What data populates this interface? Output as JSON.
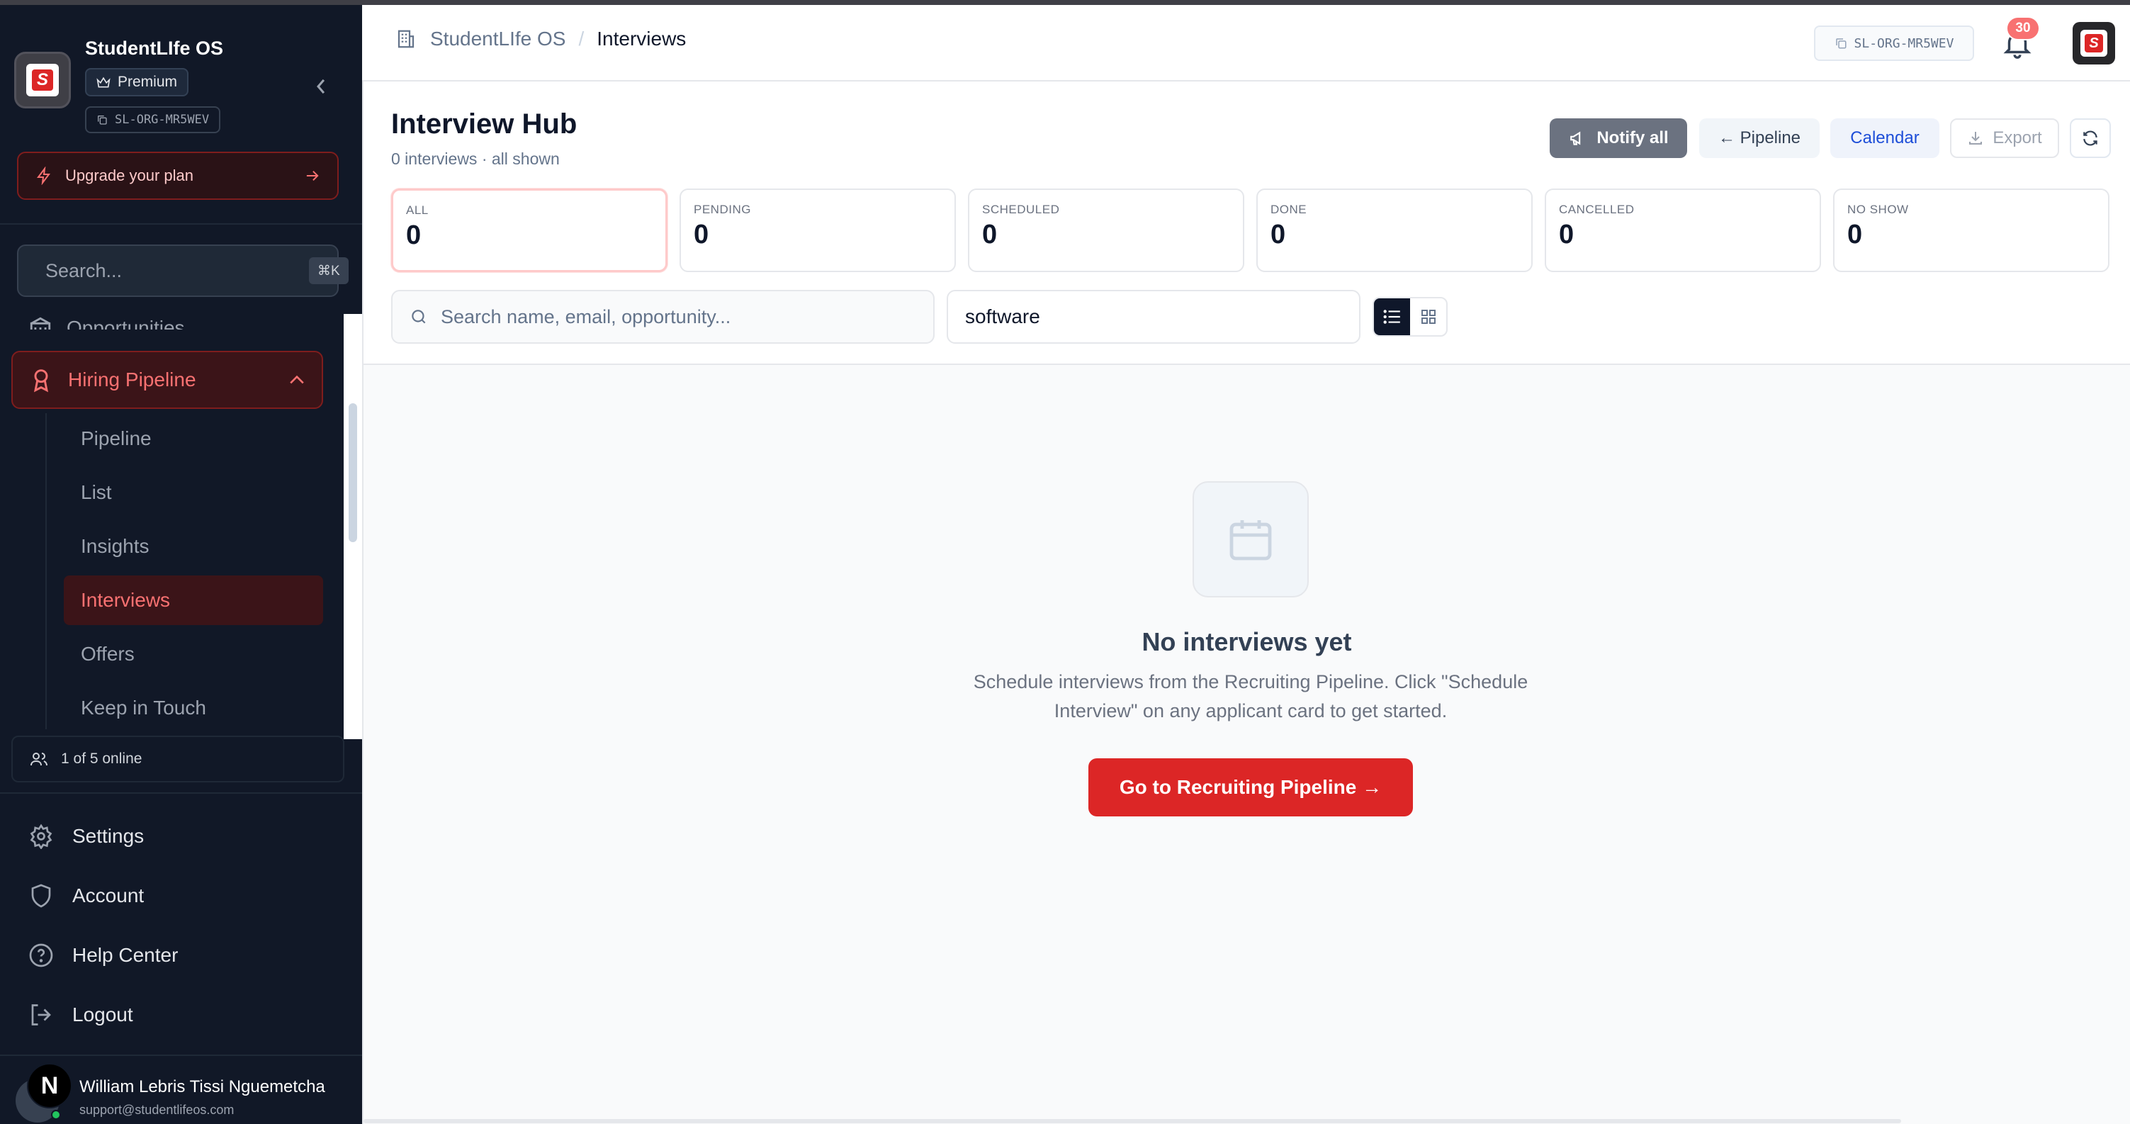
{
  "sidebar": {
    "app_name": "StudentLIfe OS",
    "plan_badge": "Premium",
    "org_id": "SL-ORG-MR5WEV",
    "upgrade_label": "Upgrade your plan",
    "search_placeholder": "Search...",
    "search_shortcut": "⌘K",
    "nav_partial_label": "Opportunities",
    "nav_group": {
      "label": "Hiring Pipeline",
      "items": [
        {
          "label": "Pipeline",
          "active": false
        },
        {
          "label": "List",
          "active": false
        },
        {
          "label": "Insights",
          "active": false
        },
        {
          "label": "Interviews",
          "active": true
        },
        {
          "label": "Offers",
          "active": false
        },
        {
          "label": "Keep in Touch",
          "active": false
        }
      ]
    },
    "online_status": "1 of 5 online",
    "bottom_items": [
      {
        "label": "Settings",
        "icon": "gear-icon"
      },
      {
        "label": "Account",
        "icon": "shield-icon"
      },
      {
        "label": "Help Center",
        "icon": "help-circle-icon"
      },
      {
        "label": "Logout",
        "icon": "logout-icon"
      }
    ],
    "user": {
      "initial": "N",
      "name": "William Lebris Tissi Nguemetcha",
      "email": "support@studentlifeos.com"
    }
  },
  "header": {
    "breadcrumb_org": "StudentLIfe OS",
    "breadcrumb_separator": "/",
    "breadcrumb_current": "Interviews",
    "org_id": "SL-ORG-MR5WEV",
    "notification_count": "30"
  },
  "page": {
    "title": "Interview Hub",
    "subtitle": "0 interviews · all shown",
    "buttons": {
      "notify_all": "Notify all",
      "pipeline": "← Pipeline",
      "calendar": "Calendar",
      "export": "Export"
    },
    "stats": [
      {
        "label": "ALL",
        "value": "0"
      },
      {
        "label": "PENDING",
        "value": "0"
      },
      {
        "label": "SCHEDULED",
        "value": "0"
      },
      {
        "label": "DONE",
        "value": "0"
      },
      {
        "label": "CANCELLED",
        "value": "0"
      },
      {
        "label": "NO SHOW",
        "value": "0"
      }
    ],
    "search_placeholder": "Search name, email, opportunity...",
    "filter_value": "software",
    "view_mode": "list"
  },
  "empty_state": {
    "title": "No interviews yet",
    "description": "Schedule interviews from the Recruiting Pipeline. Click \"Schedule Interview\" on any applicant card to get started.",
    "cta": "Go to Recruiting Pipeline →"
  },
  "colors": {
    "sidebar_bg": "#111827",
    "accent_red": "#dc2626",
    "active_nav_text": "#f87171",
    "notify_button": "#6b7280",
    "calendar_text": "#1d4ed8"
  }
}
